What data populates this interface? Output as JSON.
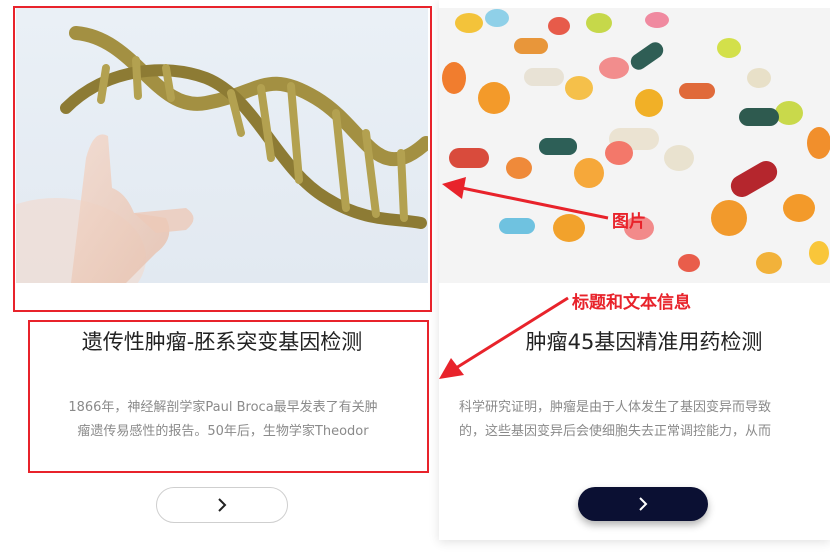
{
  "cards": [
    {
      "title": "遗传性肿瘤-胚系突变基因检测",
      "desc_line1": "1866年，神经解剖学家Paul Broca最早发表了有关肿",
      "desc_line2": "瘤遗传易感性的报告。50年后，生物学家Theodor",
      "button_icon": "chevron-right-icon",
      "image": "dna-helix-hand"
    },
    {
      "title": "肿瘤45基因精准用药检测",
      "desc_line1": "科学研究证明，肿瘤是由于人体发生了基因变异而导致",
      "desc_line2": "的，这些基因变异后会使细胞失去正常调控能力，从而",
      "button_icon": "chevron-right-icon",
      "image": "pill-dna-helix"
    }
  ],
  "annotations": {
    "image_label": "图片",
    "text_label": "标题和文本信息",
    "color": "#e8232b"
  },
  "colors": {
    "button_dark": "#0b1033",
    "title": "#222222",
    "desc": "#8a8a8a"
  }
}
